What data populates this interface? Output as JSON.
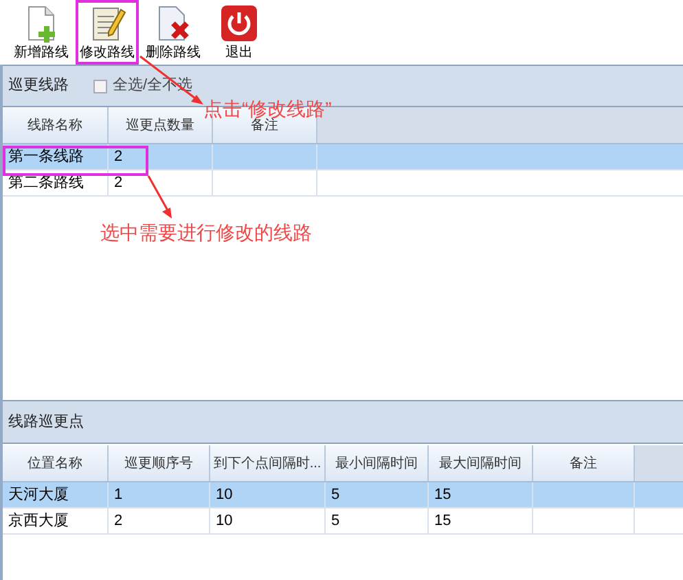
{
  "toolbar": [
    {
      "kind": "new",
      "label": "新增路线",
      "highlighted": false
    },
    {
      "kind": "edit",
      "label": "修改路线",
      "highlighted": true
    },
    {
      "kind": "delete",
      "label": "删除路线",
      "highlighted": false
    },
    {
      "kind": "exit",
      "label": "退出",
      "highlighted": false
    }
  ],
  "routes": {
    "title": "巡更线路",
    "select_all": {
      "label": "全选/全不选",
      "checked": false
    },
    "columns": [
      "线路名称",
      "巡更点数量",
      "备注"
    ],
    "rows": [
      {
        "cells": [
          "第一条线路",
          "2",
          ""
        ],
        "selected": true
      },
      {
        "cells": [
          "第二条路线",
          "2",
          ""
        ],
        "selected": false
      }
    ]
  },
  "points": {
    "title": "线路巡更点",
    "columns": [
      "位置名称",
      "巡更顺序号",
      "到下个点间隔时...",
      "最小间隔时间",
      "最大间隔时间",
      "备注"
    ],
    "rows": [
      {
        "cells": [
          "天河大厦",
          "1",
          "10",
          "5",
          "15",
          ""
        ],
        "selected": true
      },
      {
        "cells": [
          "京西大厦",
          "2",
          "10",
          "5",
          "15",
          ""
        ],
        "selected": false
      }
    ]
  },
  "annotations": [
    {
      "text": "点击“修改线路”"
    },
    {
      "text": "选中需要进行修改的线路"
    }
  ]
}
